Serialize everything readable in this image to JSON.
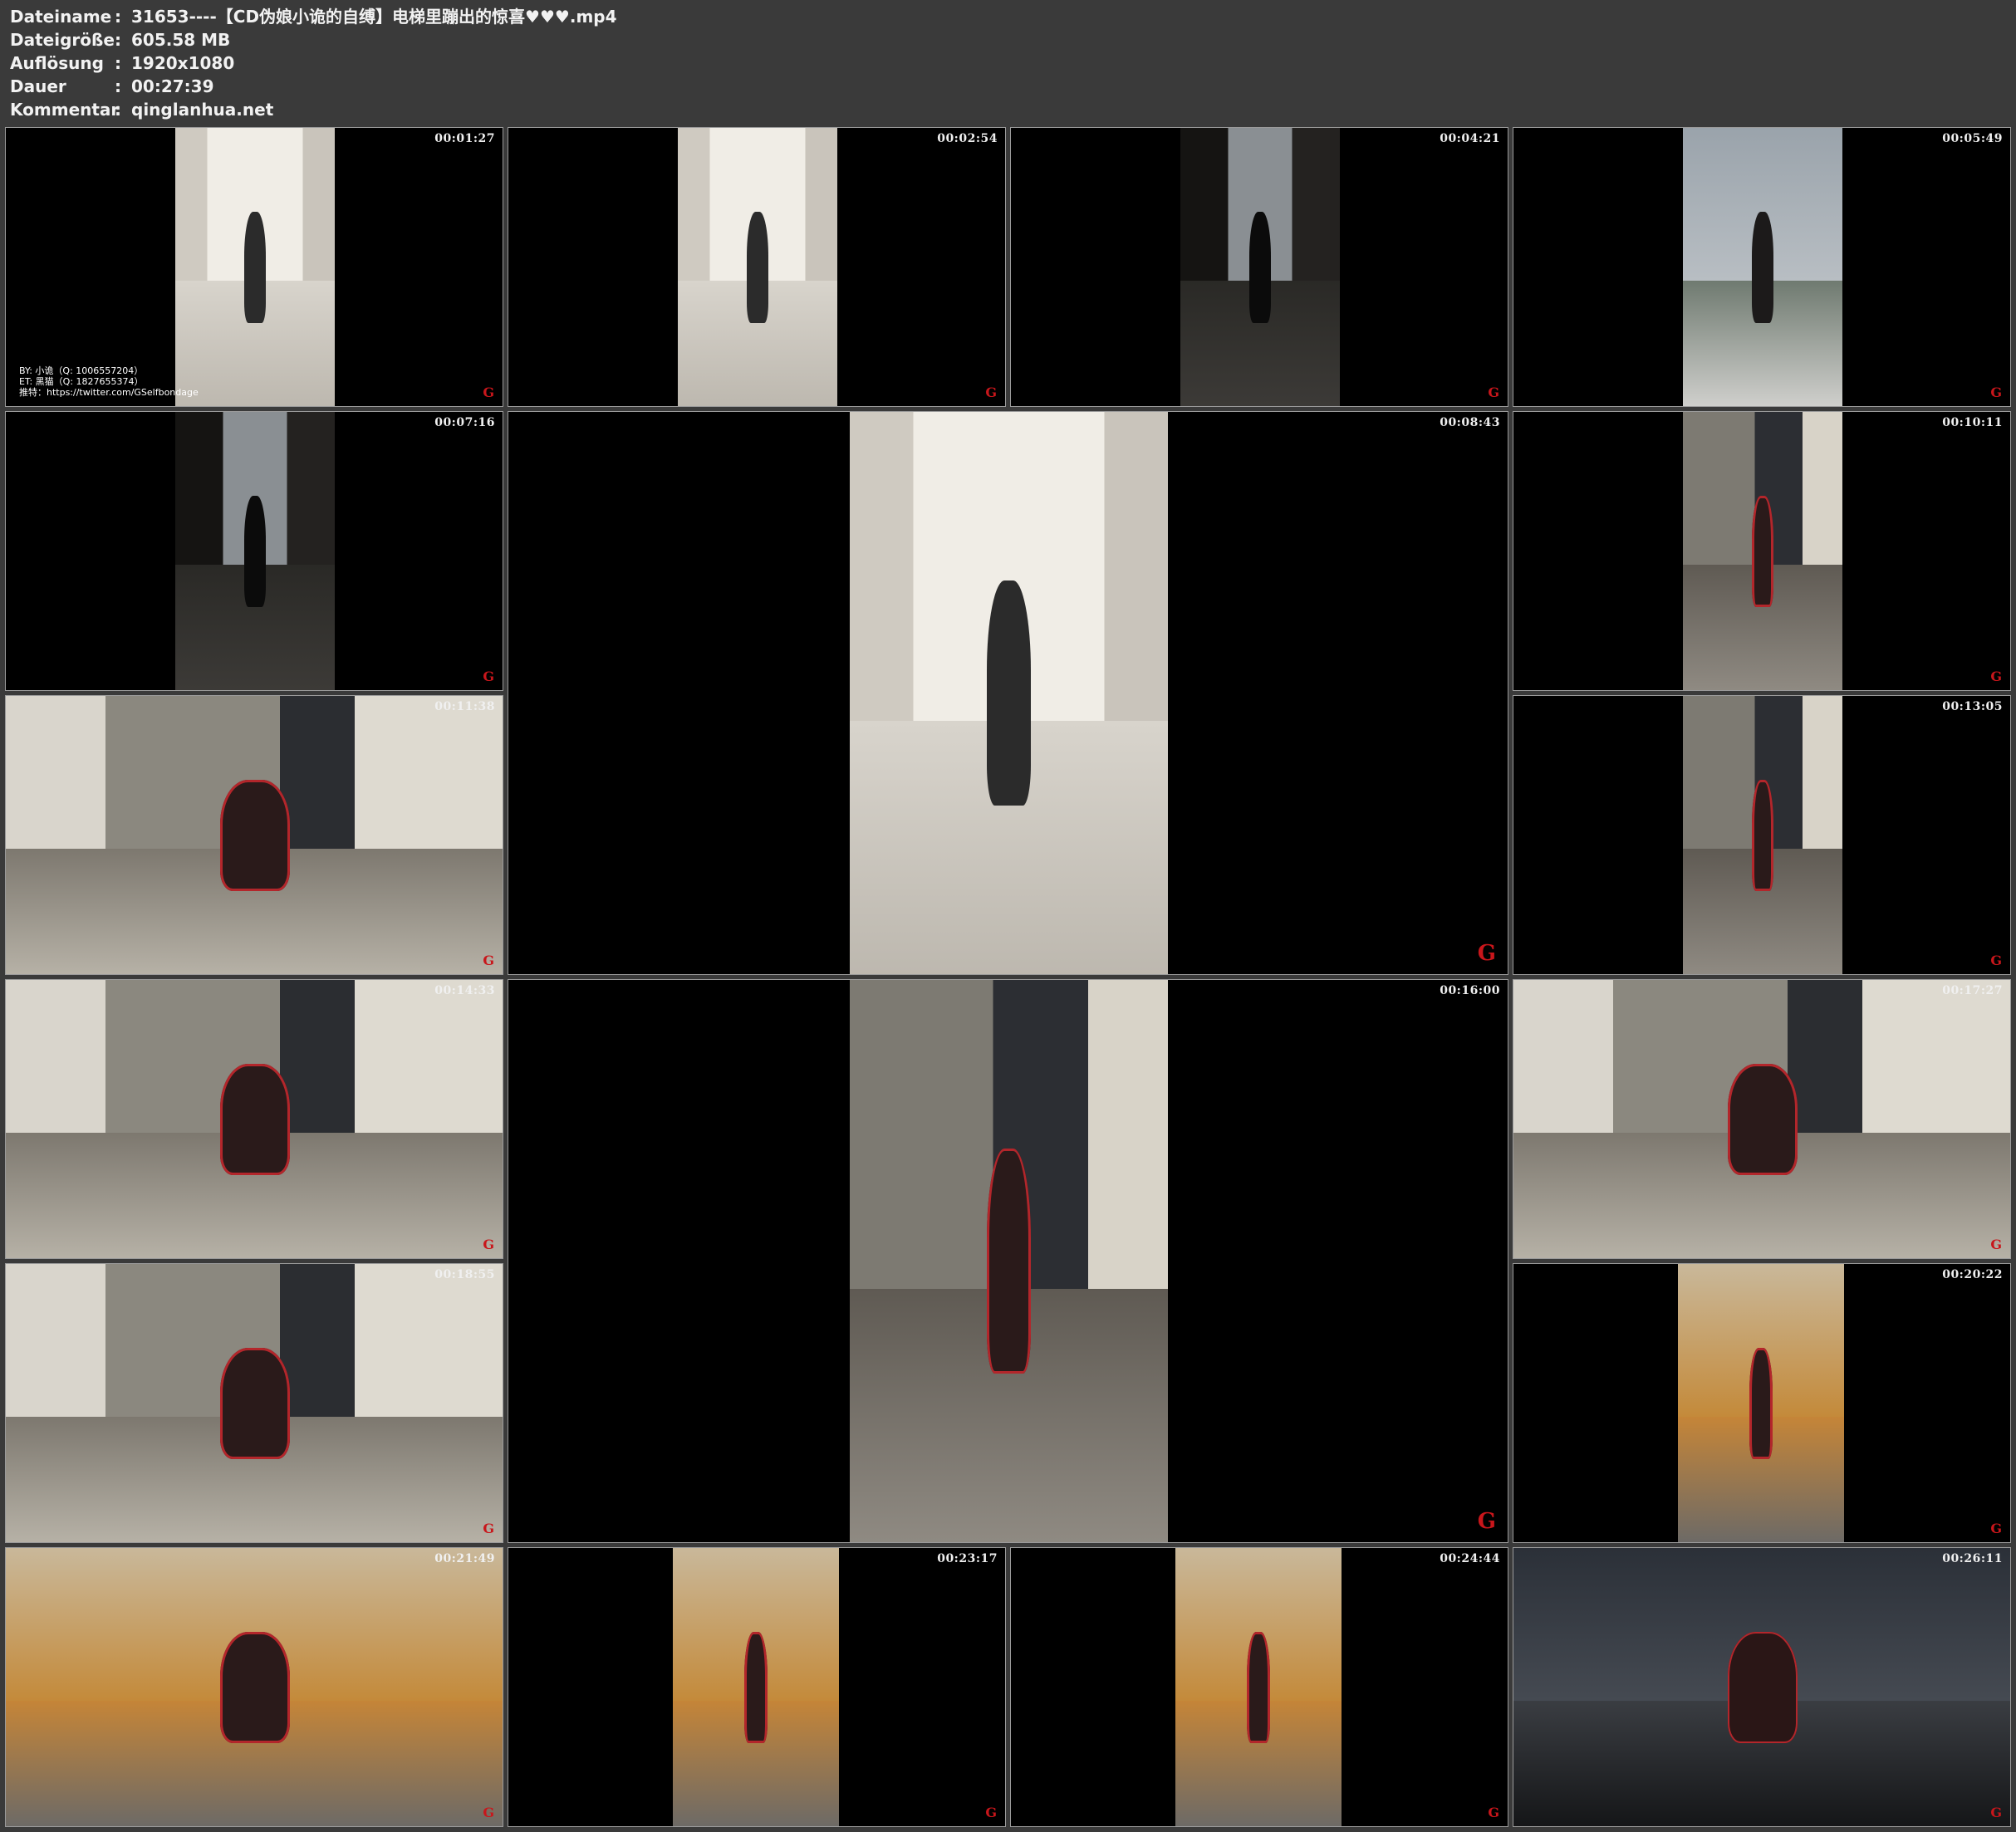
{
  "header": {
    "rows": [
      {
        "key": "Dateiname",
        "value": "31653----【CD伪娘小诡的自缚】电梯里蹦出的惊喜♥♥♥.mp4"
      },
      {
        "key": "Dateigröße",
        "value": "605.58 MB"
      },
      {
        "key": "Auflösung",
        "value": "1920x1080"
      },
      {
        "key": "Dauer",
        "value": "00:27:39"
      },
      {
        "key": "Kommentar",
        "value": "qinglanhua.net"
      }
    ],
    "separator": ":"
  },
  "credits": {
    "line1": "BY: 小诡（Q: 1006557204）",
    "line2": "ET: 黑猫（Q: 1827655374）",
    "line3": "推特：https://twitter.com/GSelfbondage"
  },
  "logo_text": "G",
  "thumbnails": [
    {
      "time": "00:01:27",
      "scene": "hall"
    },
    {
      "time": "00:02:54",
      "scene": "hall"
    },
    {
      "time": "00:04:21",
      "scene": "dark"
    },
    {
      "time": "00:05:49",
      "scene": "balcony"
    },
    {
      "time": "00:07:16",
      "scene": "dark"
    },
    {
      "time": "00:08:43",
      "scene": "hall"
    },
    {
      "time": "00:10:11",
      "scene": "room"
    },
    {
      "time": "00:11:38",
      "scene": "room-wide"
    },
    {
      "time": "00:13:05",
      "scene": "room"
    },
    {
      "time": "00:14:33",
      "scene": "room-wide"
    },
    {
      "time": "00:16:00",
      "scene": "room"
    },
    {
      "time": "00:17:27",
      "scene": "room-wide"
    },
    {
      "time": "00:18:55",
      "scene": "room-wide"
    },
    {
      "time": "00:20:22",
      "scene": "sofa"
    },
    {
      "time": "00:21:49",
      "scene": "sofa"
    },
    {
      "time": "00:23:17",
      "scene": "sofa"
    },
    {
      "time": "00:24:44",
      "scene": "sofa"
    },
    {
      "time": "00:26:11",
      "scene": "night"
    }
  ]
}
